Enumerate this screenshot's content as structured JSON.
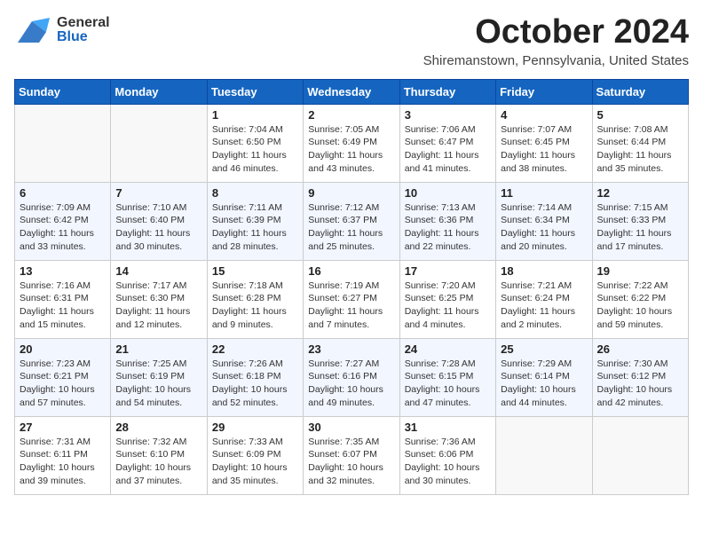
{
  "header": {
    "month_title": "October 2024",
    "location": "Shiremanstown, Pennsylvania, United States",
    "logo_general": "General",
    "logo_blue": "Blue"
  },
  "days_of_week": [
    "Sunday",
    "Monday",
    "Tuesday",
    "Wednesday",
    "Thursday",
    "Friday",
    "Saturday"
  ],
  "weeks": [
    [
      {
        "day": "",
        "info": ""
      },
      {
        "day": "",
        "info": ""
      },
      {
        "day": "1",
        "info": "Sunrise: 7:04 AM\nSunset: 6:50 PM\nDaylight: 11 hours and 46 minutes."
      },
      {
        "day": "2",
        "info": "Sunrise: 7:05 AM\nSunset: 6:49 PM\nDaylight: 11 hours and 43 minutes."
      },
      {
        "day": "3",
        "info": "Sunrise: 7:06 AM\nSunset: 6:47 PM\nDaylight: 11 hours and 41 minutes."
      },
      {
        "day": "4",
        "info": "Sunrise: 7:07 AM\nSunset: 6:45 PM\nDaylight: 11 hours and 38 minutes."
      },
      {
        "day": "5",
        "info": "Sunrise: 7:08 AM\nSunset: 6:44 PM\nDaylight: 11 hours and 35 minutes."
      }
    ],
    [
      {
        "day": "6",
        "info": "Sunrise: 7:09 AM\nSunset: 6:42 PM\nDaylight: 11 hours and 33 minutes."
      },
      {
        "day": "7",
        "info": "Sunrise: 7:10 AM\nSunset: 6:40 PM\nDaylight: 11 hours and 30 minutes."
      },
      {
        "day": "8",
        "info": "Sunrise: 7:11 AM\nSunset: 6:39 PM\nDaylight: 11 hours and 28 minutes."
      },
      {
        "day": "9",
        "info": "Sunrise: 7:12 AM\nSunset: 6:37 PM\nDaylight: 11 hours and 25 minutes."
      },
      {
        "day": "10",
        "info": "Sunrise: 7:13 AM\nSunset: 6:36 PM\nDaylight: 11 hours and 22 minutes."
      },
      {
        "day": "11",
        "info": "Sunrise: 7:14 AM\nSunset: 6:34 PM\nDaylight: 11 hours and 20 minutes."
      },
      {
        "day": "12",
        "info": "Sunrise: 7:15 AM\nSunset: 6:33 PM\nDaylight: 11 hours and 17 minutes."
      }
    ],
    [
      {
        "day": "13",
        "info": "Sunrise: 7:16 AM\nSunset: 6:31 PM\nDaylight: 11 hours and 15 minutes."
      },
      {
        "day": "14",
        "info": "Sunrise: 7:17 AM\nSunset: 6:30 PM\nDaylight: 11 hours and 12 minutes."
      },
      {
        "day": "15",
        "info": "Sunrise: 7:18 AM\nSunset: 6:28 PM\nDaylight: 11 hours and 9 minutes."
      },
      {
        "day": "16",
        "info": "Sunrise: 7:19 AM\nSunset: 6:27 PM\nDaylight: 11 hours and 7 minutes."
      },
      {
        "day": "17",
        "info": "Sunrise: 7:20 AM\nSunset: 6:25 PM\nDaylight: 11 hours and 4 minutes."
      },
      {
        "day": "18",
        "info": "Sunrise: 7:21 AM\nSunset: 6:24 PM\nDaylight: 11 hours and 2 minutes."
      },
      {
        "day": "19",
        "info": "Sunrise: 7:22 AM\nSunset: 6:22 PM\nDaylight: 10 hours and 59 minutes."
      }
    ],
    [
      {
        "day": "20",
        "info": "Sunrise: 7:23 AM\nSunset: 6:21 PM\nDaylight: 10 hours and 57 minutes."
      },
      {
        "day": "21",
        "info": "Sunrise: 7:25 AM\nSunset: 6:19 PM\nDaylight: 10 hours and 54 minutes."
      },
      {
        "day": "22",
        "info": "Sunrise: 7:26 AM\nSunset: 6:18 PM\nDaylight: 10 hours and 52 minutes."
      },
      {
        "day": "23",
        "info": "Sunrise: 7:27 AM\nSunset: 6:16 PM\nDaylight: 10 hours and 49 minutes."
      },
      {
        "day": "24",
        "info": "Sunrise: 7:28 AM\nSunset: 6:15 PM\nDaylight: 10 hours and 47 minutes."
      },
      {
        "day": "25",
        "info": "Sunrise: 7:29 AM\nSunset: 6:14 PM\nDaylight: 10 hours and 44 minutes."
      },
      {
        "day": "26",
        "info": "Sunrise: 7:30 AM\nSunset: 6:12 PM\nDaylight: 10 hours and 42 minutes."
      }
    ],
    [
      {
        "day": "27",
        "info": "Sunrise: 7:31 AM\nSunset: 6:11 PM\nDaylight: 10 hours and 39 minutes."
      },
      {
        "day": "28",
        "info": "Sunrise: 7:32 AM\nSunset: 6:10 PM\nDaylight: 10 hours and 37 minutes."
      },
      {
        "day": "29",
        "info": "Sunrise: 7:33 AM\nSunset: 6:09 PM\nDaylight: 10 hours and 35 minutes."
      },
      {
        "day": "30",
        "info": "Sunrise: 7:35 AM\nSunset: 6:07 PM\nDaylight: 10 hours and 32 minutes."
      },
      {
        "day": "31",
        "info": "Sunrise: 7:36 AM\nSunset: 6:06 PM\nDaylight: 10 hours and 30 minutes."
      },
      {
        "day": "",
        "info": ""
      },
      {
        "day": "",
        "info": ""
      }
    ]
  ]
}
